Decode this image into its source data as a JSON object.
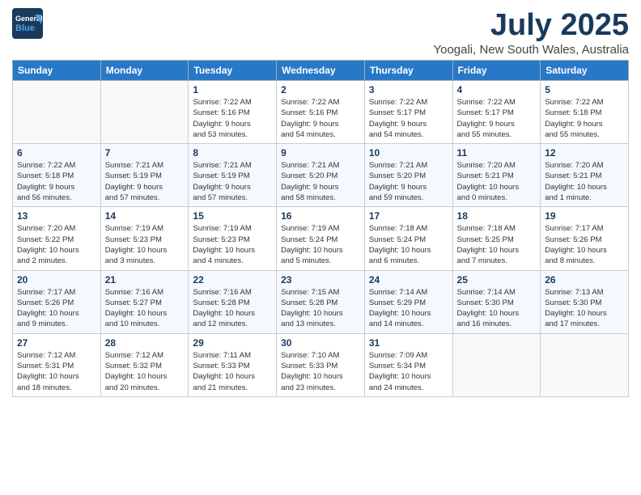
{
  "header": {
    "logo_general": "General",
    "logo_blue": "Blue",
    "month_title": "July 2025",
    "location": "Yoogali, New South Wales, Australia"
  },
  "weekdays": [
    "Sunday",
    "Monday",
    "Tuesday",
    "Wednesday",
    "Thursday",
    "Friday",
    "Saturday"
  ],
  "weeks": [
    [
      {
        "day": "",
        "info": ""
      },
      {
        "day": "",
        "info": ""
      },
      {
        "day": "1",
        "info": "Sunrise: 7:22 AM\nSunset: 5:16 PM\nDaylight: 9 hours\nand 53 minutes."
      },
      {
        "day": "2",
        "info": "Sunrise: 7:22 AM\nSunset: 5:16 PM\nDaylight: 9 hours\nand 54 minutes."
      },
      {
        "day": "3",
        "info": "Sunrise: 7:22 AM\nSunset: 5:17 PM\nDaylight: 9 hours\nand 54 minutes."
      },
      {
        "day": "4",
        "info": "Sunrise: 7:22 AM\nSunset: 5:17 PM\nDaylight: 9 hours\nand 55 minutes."
      },
      {
        "day": "5",
        "info": "Sunrise: 7:22 AM\nSunset: 5:18 PM\nDaylight: 9 hours\nand 55 minutes."
      }
    ],
    [
      {
        "day": "6",
        "info": "Sunrise: 7:22 AM\nSunset: 5:18 PM\nDaylight: 9 hours\nand 56 minutes."
      },
      {
        "day": "7",
        "info": "Sunrise: 7:21 AM\nSunset: 5:19 PM\nDaylight: 9 hours\nand 57 minutes."
      },
      {
        "day": "8",
        "info": "Sunrise: 7:21 AM\nSunset: 5:19 PM\nDaylight: 9 hours\nand 57 minutes."
      },
      {
        "day": "9",
        "info": "Sunrise: 7:21 AM\nSunset: 5:20 PM\nDaylight: 9 hours\nand 58 minutes."
      },
      {
        "day": "10",
        "info": "Sunrise: 7:21 AM\nSunset: 5:20 PM\nDaylight: 9 hours\nand 59 minutes."
      },
      {
        "day": "11",
        "info": "Sunrise: 7:20 AM\nSunset: 5:21 PM\nDaylight: 10 hours\nand 0 minutes."
      },
      {
        "day": "12",
        "info": "Sunrise: 7:20 AM\nSunset: 5:21 PM\nDaylight: 10 hours\nand 1 minute."
      }
    ],
    [
      {
        "day": "13",
        "info": "Sunrise: 7:20 AM\nSunset: 5:22 PM\nDaylight: 10 hours\nand 2 minutes."
      },
      {
        "day": "14",
        "info": "Sunrise: 7:19 AM\nSunset: 5:23 PM\nDaylight: 10 hours\nand 3 minutes."
      },
      {
        "day": "15",
        "info": "Sunrise: 7:19 AM\nSunset: 5:23 PM\nDaylight: 10 hours\nand 4 minutes."
      },
      {
        "day": "16",
        "info": "Sunrise: 7:19 AM\nSunset: 5:24 PM\nDaylight: 10 hours\nand 5 minutes."
      },
      {
        "day": "17",
        "info": "Sunrise: 7:18 AM\nSunset: 5:24 PM\nDaylight: 10 hours\nand 6 minutes."
      },
      {
        "day": "18",
        "info": "Sunrise: 7:18 AM\nSunset: 5:25 PM\nDaylight: 10 hours\nand 7 minutes."
      },
      {
        "day": "19",
        "info": "Sunrise: 7:17 AM\nSunset: 5:26 PM\nDaylight: 10 hours\nand 8 minutes."
      }
    ],
    [
      {
        "day": "20",
        "info": "Sunrise: 7:17 AM\nSunset: 5:26 PM\nDaylight: 10 hours\nand 9 minutes."
      },
      {
        "day": "21",
        "info": "Sunrise: 7:16 AM\nSunset: 5:27 PM\nDaylight: 10 hours\nand 10 minutes."
      },
      {
        "day": "22",
        "info": "Sunrise: 7:16 AM\nSunset: 5:28 PM\nDaylight: 10 hours\nand 12 minutes."
      },
      {
        "day": "23",
        "info": "Sunrise: 7:15 AM\nSunset: 5:28 PM\nDaylight: 10 hours\nand 13 minutes."
      },
      {
        "day": "24",
        "info": "Sunrise: 7:14 AM\nSunset: 5:29 PM\nDaylight: 10 hours\nand 14 minutes."
      },
      {
        "day": "25",
        "info": "Sunrise: 7:14 AM\nSunset: 5:30 PM\nDaylight: 10 hours\nand 16 minutes."
      },
      {
        "day": "26",
        "info": "Sunrise: 7:13 AM\nSunset: 5:30 PM\nDaylight: 10 hours\nand 17 minutes."
      }
    ],
    [
      {
        "day": "27",
        "info": "Sunrise: 7:12 AM\nSunset: 5:31 PM\nDaylight: 10 hours\nand 18 minutes."
      },
      {
        "day": "28",
        "info": "Sunrise: 7:12 AM\nSunset: 5:32 PM\nDaylight: 10 hours\nand 20 minutes."
      },
      {
        "day": "29",
        "info": "Sunrise: 7:11 AM\nSunset: 5:33 PM\nDaylight: 10 hours\nand 21 minutes."
      },
      {
        "day": "30",
        "info": "Sunrise: 7:10 AM\nSunset: 5:33 PM\nDaylight: 10 hours\nand 23 minutes."
      },
      {
        "day": "31",
        "info": "Sunrise: 7:09 AM\nSunset: 5:34 PM\nDaylight: 10 hours\nand 24 minutes."
      },
      {
        "day": "",
        "info": ""
      },
      {
        "day": "",
        "info": ""
      }
    ]
  ]
}
